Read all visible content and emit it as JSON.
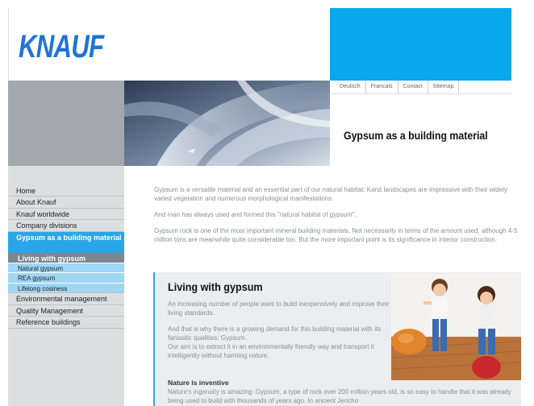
{
  "header": {
    "logo": "KNAUF",
    "top_links": [
      "Deutsch",
      "Francais",
      "Contact",
      "Sitemap"
    ],
    "page_title": "Gypsum as a building material"
  },
  "sidebar": {
    "items": [
      {
        "label": "Home",
        "state": "normal"
      },
      {
        "label": "About Knauf",
        "state": "normal"
      },
      {
        "label": "Knauf worldwide",
        "state": "normal"
      },
      {
        "label": "Company divisions",
        "state": "normal"
      },
      {
        "label": "Gypsum as a building material",
        "state": "active"
      },
      {
        "label": "Living with gypsum",
        "state": "current"
      },
      {
        "label": "Natural gypsum",
        "state": "sub"
      },
      {
        "label": "REA gypsum",
        "state": "sub"
      },
      {
        "label": "Lifelong cosiness",
        "state": "sub"
      },
      {
        "label": "Environmental management",
        "state": "normal"
      },
      {
        "label": "Quality Management",
        "state": "normal"
      },
      {
        "label": "Reference buildings",
        "state": "normal"
      }
    ]
  },
  "main": {
    "paragraphs": [
      "Gypsum is a versatile material and an essential part of our natural habitat: Karst landscapes are impressive with their widely varied vegetation and numerous morphological manifestations.",
      "And man has always used and formed this \"natural habitat of gypsum\".",
      "Gypsum rock is one of the most important mineral building materials. Not necessarily in terms of the amount used, although 4-5 million tons are meanwhile quite considerable too. But the more important point is its significance in interior construction."
    ]
  },
  "feature": {
    "heading": "Living with gypsum",
    "p1": "An increasing number of people want to build inexpensively and improve their living standards.",
    "p2": "And that is why there is a growing demand for this building material with its fantastic qualities: Gypsum.",
    "p3": "Our aim is to extract it in an environmentally friendly way and transport it intelligently without harming nature.",
    "subheading": "Nature is inventive",
    "bottom": "Nature's ingenuity is amazing: Gypsum, a type of rock over 200 million years old, is so easy to handle that it was already being used to build with thousands of years ago. In ancient Jericho"
  },
  "colors": {
    "brand_blue": "#1e74d8",
    "accent_blue": "#09a8ec",
    "nav_active": "#2aa6e8",
    "nav_sub": "#9fd6f3",
    "sidebar_bg": "#dcdedf"
  }
}
